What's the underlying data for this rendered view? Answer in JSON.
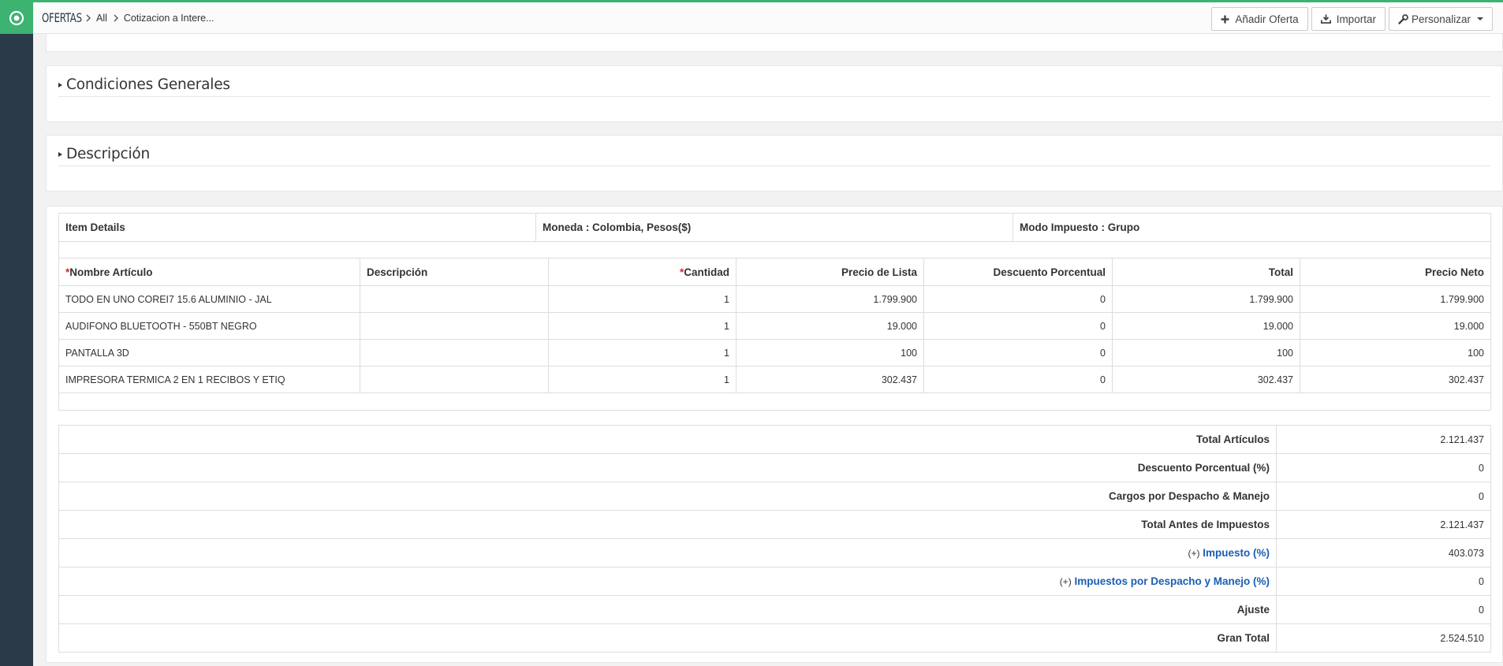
{
  "app": {
    "module": "OFERTAS",
    "breadcrumb": [
      "All",
      "Cotizacion a Intere..."
    ]
  },
  "toolbar": {
    "add_label": "Añadir Oferta",
    "import_label": "Importar",
    "customize_label": "Personalizar"
  },
  "sections": {
    "general": "Condiciones Generales",
    "description": "Descripción"
  },
  "item_info": {
    "details": "Item Details",
    "currency": "Moneda : Colombia, Pesos($)",
    "tax_mode": "Modo Impuesto : Grupo"
  },
  "items_table": {
    "required_mark": "*",
    "headers": {
      "name": "Nombre Artículo",
      "description": "Descripción",
      "quantity": "Cantidad",
      "list_price": "Precio de Lista",
      "discount": "Descuento Porcentual",
      "total": "Total",
      "net_price": "Precio Neto"
    },
    "rows": [
      {
        "name": "TODO EN UNO COREI7 15.6 ALUMINIO - JAL",
        "description": "",
        "quantity": "1",
        "list_price": "1.799.900",
        "discount": "0",
        "total": "1.799.900",
        "net_price": "1.799.900"
      },
      {
        "name": "AUDIFONO BLUETOOTH - 550BT NEGRO",
        "description": "",
        "quantity": "1",
        "list_price": "19.000",
        "discount": "0",
        "total": "19.000",
        "net_price": "19.000"
      },
      {
        "name": "PANTALLA 3D",
        "description": "",
        "quantity": "1",
        "list_price": "100",
        "discount": "0",
        "total": "100",
        "net_price": "100"
      },
      {
        "name": "IMPRESORA TERMICA 2 EN 1 RECIBOS Y ETIQ",
        "description": "",
        "quantity": "1",
        "list_price": "302.437",
        "discount": "0",
        "total": "302.437",
        "net_price": "302.437"
      }
    ]
  },
  "totals": {
    "plus_prefix": "(+)",
    "rows": [
      {
        "label": "Total Artículos",
        "value": "2.121.437"
      },
      {
        "label": "Descuento Porcentual (%)",
        "value": "0"
      },
      {
        "label": "Cargos por Despacho & Manejo",
        "value": "0"
      },
      {
        "label": "Total Antes de Impuestos",
        "value": "2.121.437"
      },
      {
        "label": "Impuesto (%)",
        "value": "403.073"
      },
      {
        "label": "Impuestos por Despacho y Manejo (%)",
        "value": "0"
      },
      {
        "label": "Ajuste",
        "value": "0"
      },
      {
        "label": "Gran Total",
        "value": "2.524.510"
      }
    ]
  },
  "colors": {
    "brand": "#3cb371",
    "sidebar": "#2b3a48",
    "link": "#1a5fb4",
    "required": "#d9262e"
  }
}
